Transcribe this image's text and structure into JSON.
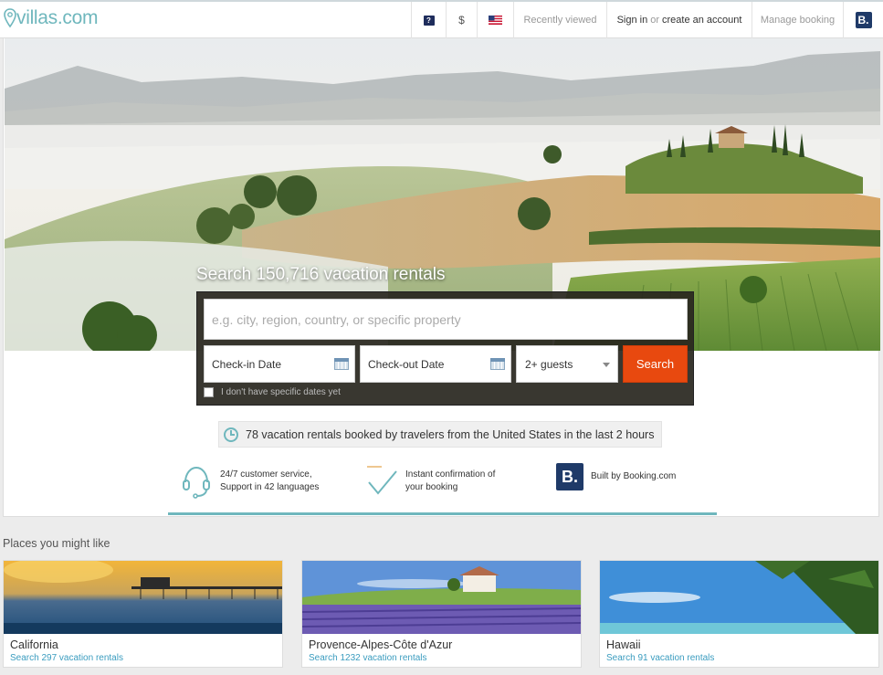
{
  "header": {
    "logo": "villas.com",
    "help_label": "?",
    "currency": "$",
    "recently_viewed": "Recently viewed",
    "sign_in": "Sign in",
    "or": "or",
    "create_account": "create an account",
    "manage_booking": "Manage booking",
    "booking_badge": "B."
  },
  "hero": {
    "title": "Search 150,716 vacation rentals",
    "search_placeholder": "e.g. city, region, country, or specific property",
    "checkin": "Check-in Date",
    "checkout": "Check-out Date",
    "guests": "2+ guests",
    "search_button": "Search",
    "no_dates": "I don't have specific dates yet"
  },
  "booked_banner": "78 vacation rentals booked by travelers from the United States in the last 2 hours",
  "features": [
    {
      "line1": "24/7 customer service,",
      "line2": "Support in 42 languages",
      "icon": "headset-icon"
    },
    {
      "line1": "Instant confirmation of",
      "line2": "your booking",
      "icon": "checkmark-icon"
    },
    {
      "line1": "Built by Booking.com",
      "line2": "",
      "icon": "booking-logo-icon"
    }
  ],
  "places": {
    "title": "Places you might like",
    "cards": [
      {
        "name": "California",
        "link": "Search 297 vacation rentals"
      },
      {
        "name": "Provence-Alpes-Côte d'Azur",
        "link": "Search 1232 vacation rentals"
      },
      {
        "name": "Hawaii",
        "link": "Search 91 vacation rentals"
      }
    ]
  },
  "colors": {
    "accent": "#6fb7bd",
    "search_button": "#e8490f",
    "booking_blue": "#1f3a68",
    "link": "#3a9cbf"
  }
}
